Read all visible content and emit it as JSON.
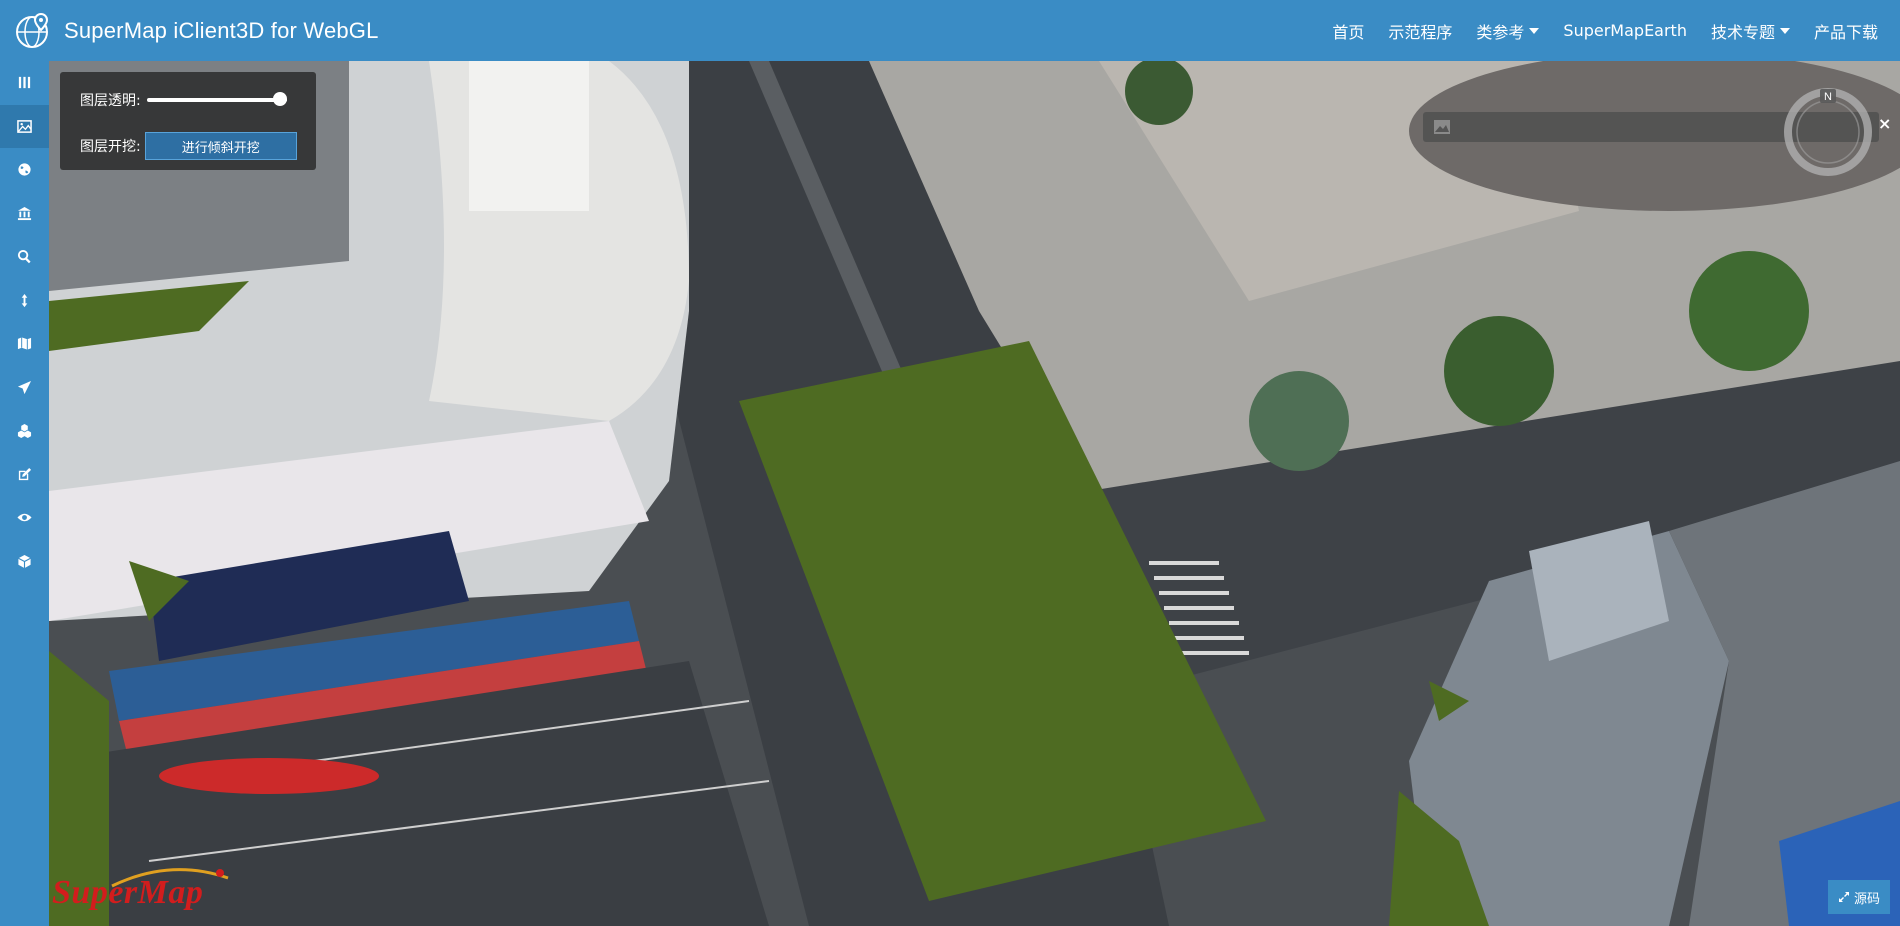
{
  "header": {
    "title": "SuperMap iClient3D for WebGL",
    "nav": [
      {
        "label": "首页"
      },
      {
        "label": "示范程序"
      },
      {
        "label": "类参考",
        "dropdown": true
      },
      {
        "label": "SuperMapEarth"
      },
      {
        "label": "技术专题",
        "dropdown": true
      },
      {
        "label": "产品下载"
      }
    ]
  },
  "sidebar": {
    "items": [
      {
        "icon": "menu-toggle-icon",
        "active": false
      },
      {
        "icon": "layer-excavation-icon",
        "active": true
      },
      {
        "icon": "globe-icon",
        "active": false
      },
      {
        "icon": "bank-icon",
        "active": false
      },
      {
        "icon": "search-icon",
        "active": false
      },
      {
        "icon": "vertical-measure-icon",
        "active": false
      },
      {
        "icon": "map-icon",
        "active": false
      },
      {
        "icon": "send-icon",
        "active": false
      },
      {
        "icon": "cubes-icon",
        "active": false
      },
      {
        "icon": "edit-icon",
        "active": false
      },
      {
        "icon": "eye-icon",
        "active": false
      },
      {
        "icon": "cube-icon",
        "active": false
      }
    ]
  },
  "panel": {
    "opacity_label": "图层透明:",
    "opacity_value": 1.0,
    "excavate_label": "图层开挖:",
    "excavate_button": "进行倾斜开挖"
  },
  "compass": {
    "north_label": "N"
  },
  "close_label": "×",
  "logo": {
    "text": "SuperMap"
  },
  "source_button": {
    "label": "源码"
  },
  "colors": {
    "navbar": "#3a8cc5",
    "excavation_fill": "#4e6b22",
    "logo_red": "#d21d1d"
  }
}
